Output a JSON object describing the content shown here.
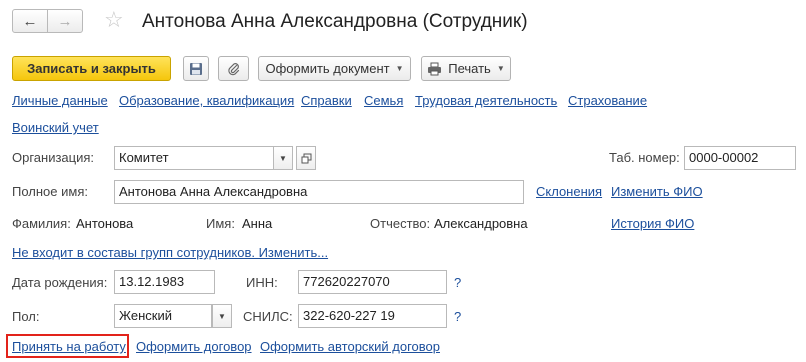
{
  "header": {
    "title": "Антонова Анна Александровна (Сотрудник)",
    "back_icon": "←",
    "forward_icon": "→",
    "star_icon": "☆"
  },
  "toolbar": {
    "save_close_label": "Записать и закрыть",
    "save_icon": "floppy-disk",
    "attach_icon": "paperclip",
    "create_document_label": "Оформить документ",
    "print_label": "Печать"
  },
  "tabs": [
    "Личные данные",
    "Образование, квалификация",
    "Справки",
    "Семья",
    "Трудовая деятельность",
    "Страхование",
    "Воинский учет"
  ],
  "form": {
    "organization_label": "Организация:",
    "organization_value": "Комитет",
    "tab_number_label": "Таб. номер:",
    "tab_number_value": "0000-00002",
    "full_name_label": "Полное имя:",
    "full_name_value": "Антонова Анна Александровна",
    "declensions_link": "Склонения",
    "change_name_link": "Изменить ФИО",
    "surname_label": "Фамилия:",
    "surname_value": "Антонова",
    "name_label": "Имя:",
    "name_value": "Анна",
    "patronymic_label": "Отчество:",
    "patronymic_value": "Александровна",
    "name_history_link": "История ФИО",
    "groups_link": "Не входит в составы групп сотрудников. Изменить...",
    "birth_date_label": "Дата рождения:",
    "birth_date_value": "13.12.1983",
    "inn_label": "ИНН:",
    "inn_value": "772620227070",
    "gender_label": "Пол:",
    "gender_value": "Женский",
    "snils_label": "СНИЛС:",
    "snils_value": "322-620-227 19",
    "help_mark": "?"
  },
  "actions": {
    "hire_link": "Принять на работу",
    "contract_link": "Оформить договор",
    "author_contract_link": "Оформить авторский договор"
  },
  "colors": {
    "link": "#1c4f9c",
    "primary_button": "#f5c60c",
    "highlight_border": "#e2231a"
  }
}
